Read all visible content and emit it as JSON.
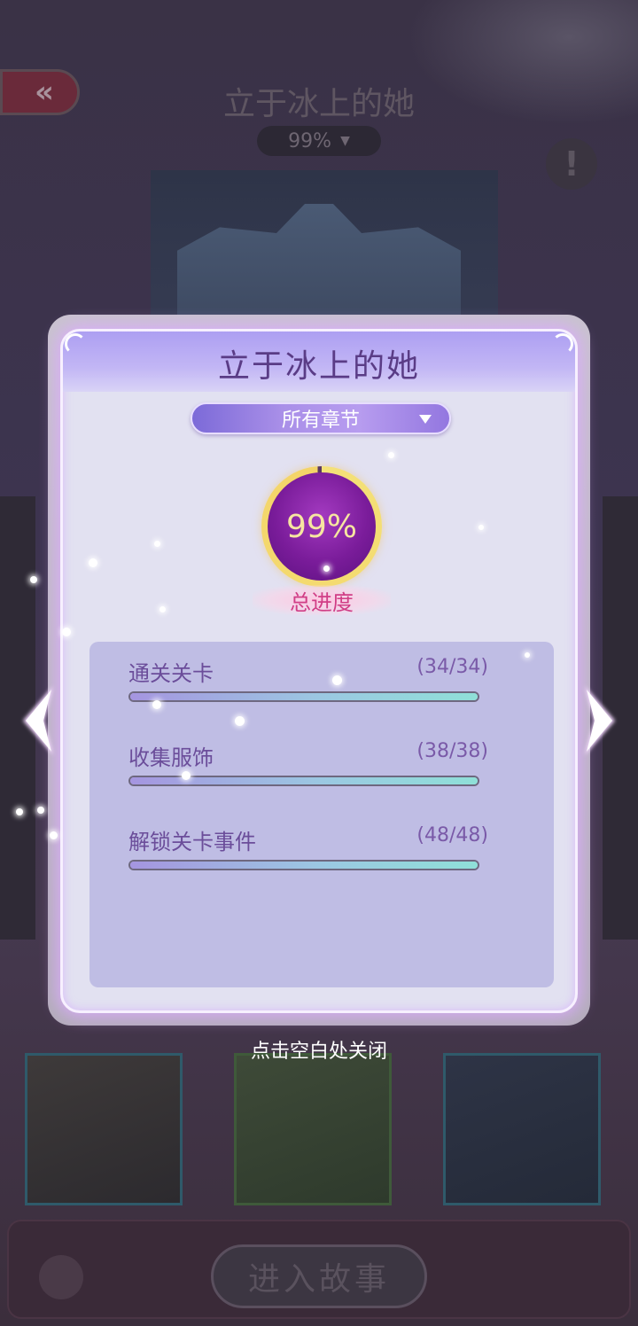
{
  "background": {
    "story_title": "立于冰上的她",
    "progress_dropdown": "99%",
    "info_icon": "!",
    "enter_story_button": "进入故事"
  },
  "dialog": {
    "title": "立于冰上的她",
    "chapter_selector": "所有章节",
    "total_progress_value": "99%",
    "total_progress_fraction": 0.99,
    "total_progress_label": "总进度",
    "stats": [
      {
        "label": "通关关卡",
        "count": "(34/34)",
        "fraction": 1.0
      },
      {
        "label": "收集服饰",
        "count": "(38/38)",
        "fraction": 1.0
      },
      {
        "label": "解锁关卡事件",
        "count": "(48/48)",
        "fraction": 1.0
      }
    ],
    "close_hint": "点击空白处关闭"
  },
  "icons": {
    "back": "double-chevron-left-icon",
    "info": "exclamation-icon",
    "prev": "chevron-left-icon",
    "next": "chevron-right-icon",
    "dropdown": "triangle-down-icon",
    "book": "book-icon"
  },
  "colors": {
    "accent_purple": "#7a1c9a",
    "ring_gold": "#f4d468",
    "title_purple": "#5a3c86",
    "label_pink": "#d03e86",
    "bar_start": "#a595e0",
    "bar_end": "#8fe0d8"
  }
}
